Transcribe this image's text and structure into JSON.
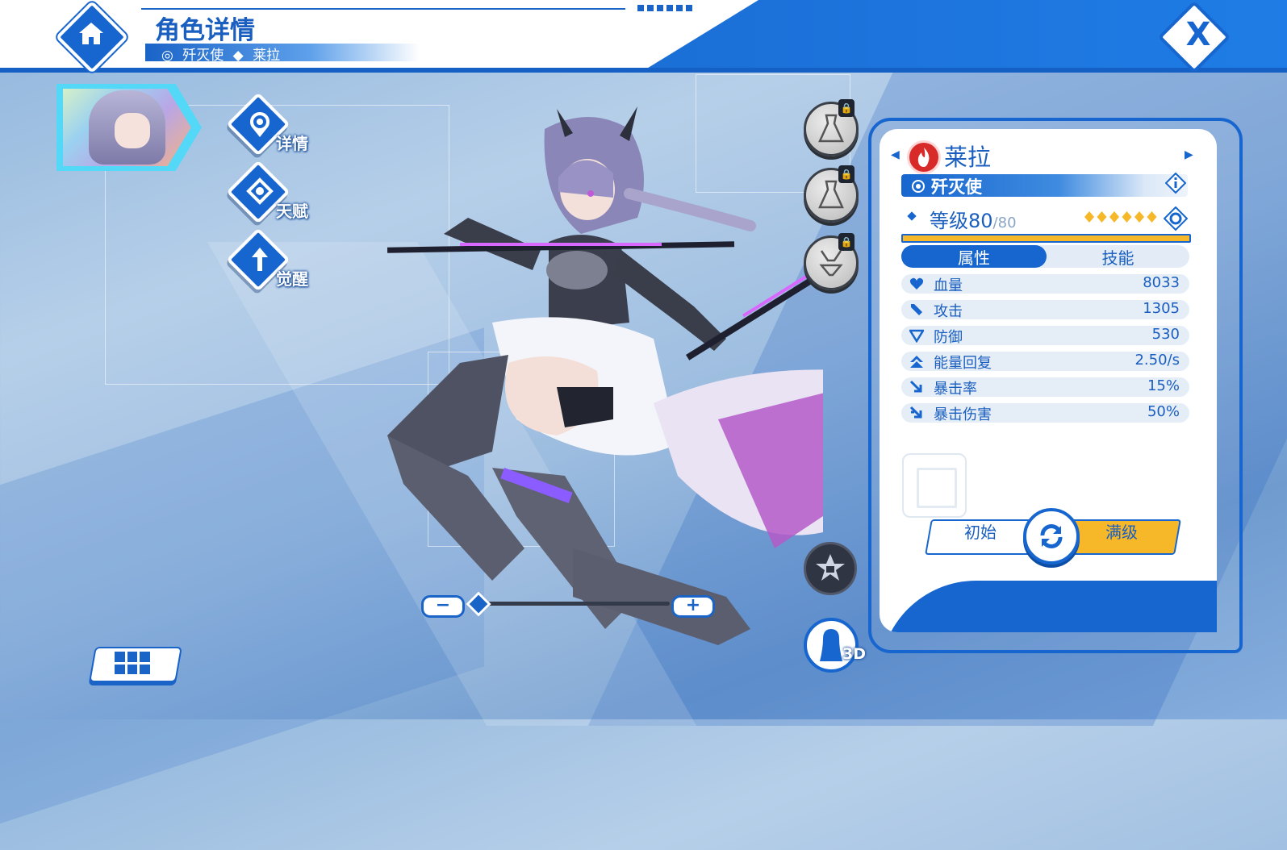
{
  "header": {
    "title": "角色详情",
    "breadcrumb_class": "歼灭使",
    "breadcrumb_name": "莱拉"
  },
  "side_menu": [
    {
      "label": "详情",
      "icon": "location-pin-icon"
    },
    {
      "label": "天赋",
      "icon": "talent-icon"
    },
    {
      "label": "觉醒",
      "icon": "awaken-arrow-icon"
    }
  ],
  "character": {
    "name": "莱拉",
    "element_icon": "fire-icon",
    "class": "歼灭使",
    "level_label": "等级80",
    "level_max": "/80",
    "stars": 6,
    "level_progress": 1.0
  },
  "tabs": {
    "attributes": "属性",
    "skills": "技能",
    "active": "属性"
  },
  "stats": [
    {
      "label": "血量",
      "value": "8033",
      "icon": "heart-icon"
    },
    {
      "label": "攻击",
      "value": "1305",
      "icon": "sword-icon"
    },
    {
      "label": "防御",
      "value": "530",
      "icon": "shield-icon"
    },
    {
      "label": "能量回复",
      "value": "2.50/s",
      "icon": "energy-icon"
    },
    {
      "label": "暴击率",
      "value": "15%",
      "icon": "crit-rate-icon"
    },
    {
      "label": "暴击伤害",
      "value": "50%",
      "icon": "crit-damage-icon"
    }
  ],
  "level_switch": {
    "initial": "初始",
    "max": "满级"
  },
  "view": {
    "label_3d": "3D"
  },
  "colors": {
    "primary": "#1766cf",
    "accent_gold": "#f6b829",
    "fire": "#d92a2a"
  }
}
